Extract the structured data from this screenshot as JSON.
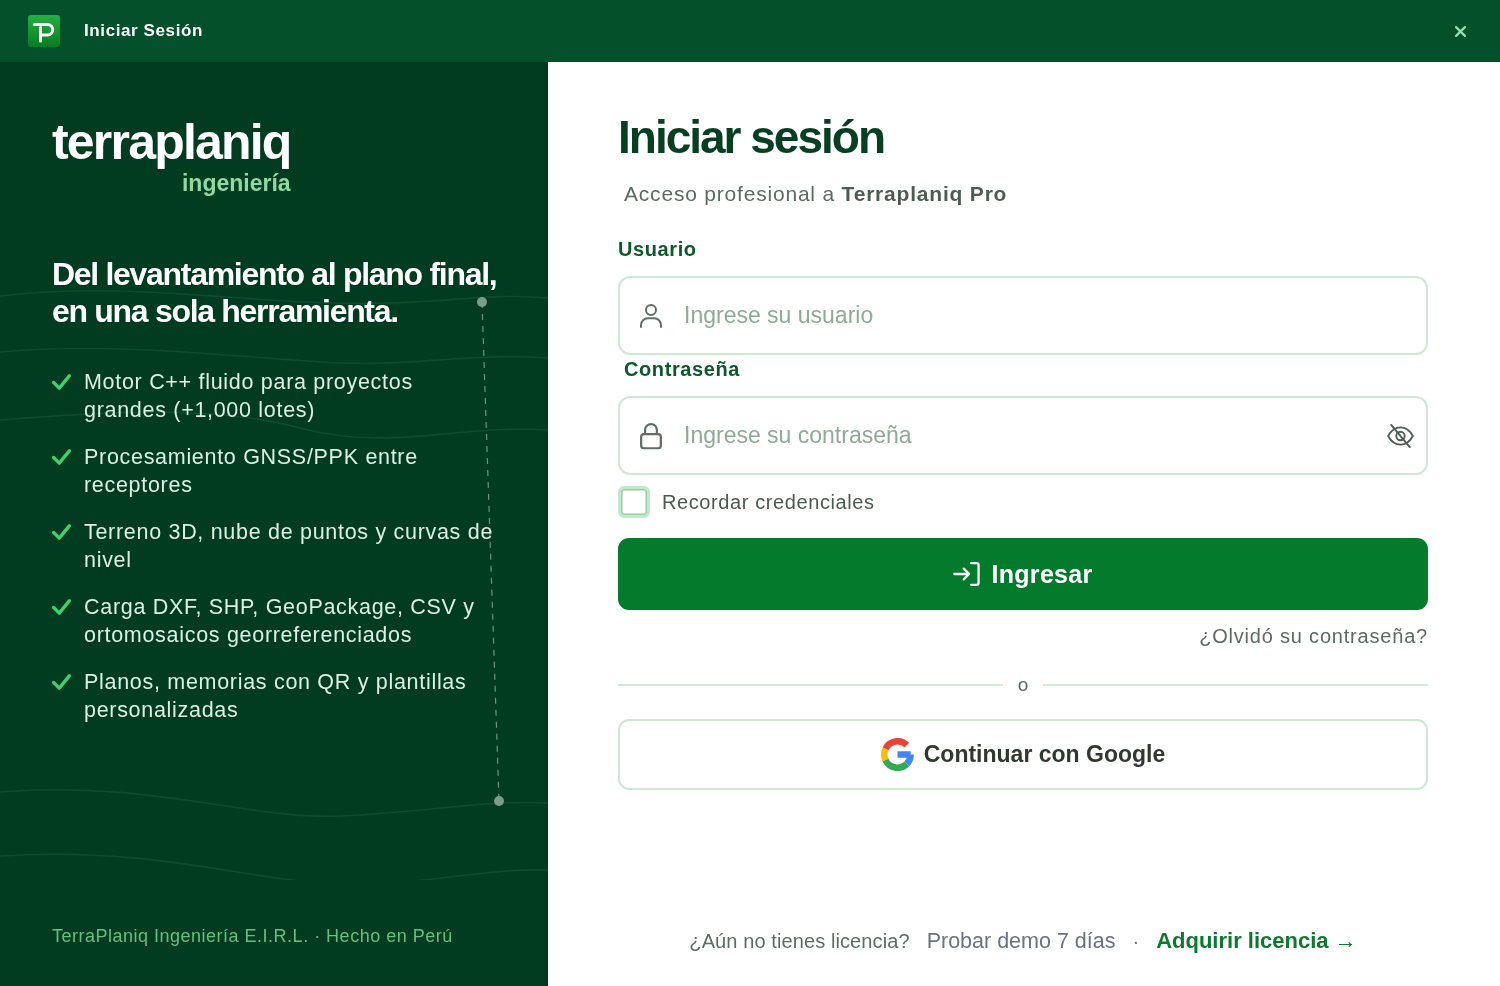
{
  "window": {
    "title": "Iniciar Sesión"
  },
  "brand_panel": {
    "wordmark": "terraplaniq",
    "tagline": "ingeniería",
    "headline": "Del levantamiento al plano final, en una sola herramienta.",
    "features": [
      "Motor C++ fluido para proyectos grandes (+1,000 lotes)",
      "Procesamiento GNSS/PPK entre receptores",
      "Terreno 3D, nube de puntos y curvas de nivel",
      "Carga DXF, SHP, GeoPackage, CSV y ortomosaicos georreferenciados",
      "Planos, memorias con QR y plantillas personalizadas"
    ],
    "footer": "TerraPlaniq Ingeniería E.I.R.L. · Hecho en Perú"
  },
  "login_form": {
    "title": "Iniciar sesión",
    "subtitle": "Acceso profesional a **Terraplaniq Pro**",
    "fields": [
      {
        "kind": "text",
        "label": "Usuario",
        "placeholder": "Ingrese su usuario"
      },
      {
        "kind": "password",
        "label": "Contraseña",
        "placeholder": "Ingrese su contraseña"
      }
    ],
    "remember": {
      "label": "Recordar credenciales",
      "checked": false
    },
    "submit_button": "Ingresar",
    "forgot_link": "¿Olvidó su contraseña?",
    "divider": "o",
    "google_button": "Continuar con Google"
  },
  "license_prompt": {
    "text": "¿Aún no tienes licencia?",
    "links": [
      {
        "kind": "secondary",
        "label": "Probar demo 7 días"
      },
      {
        "kind": "primary",
        "label": "Adquirir licencia →"
      }
    ],
    "separator": "·"
  }
}
